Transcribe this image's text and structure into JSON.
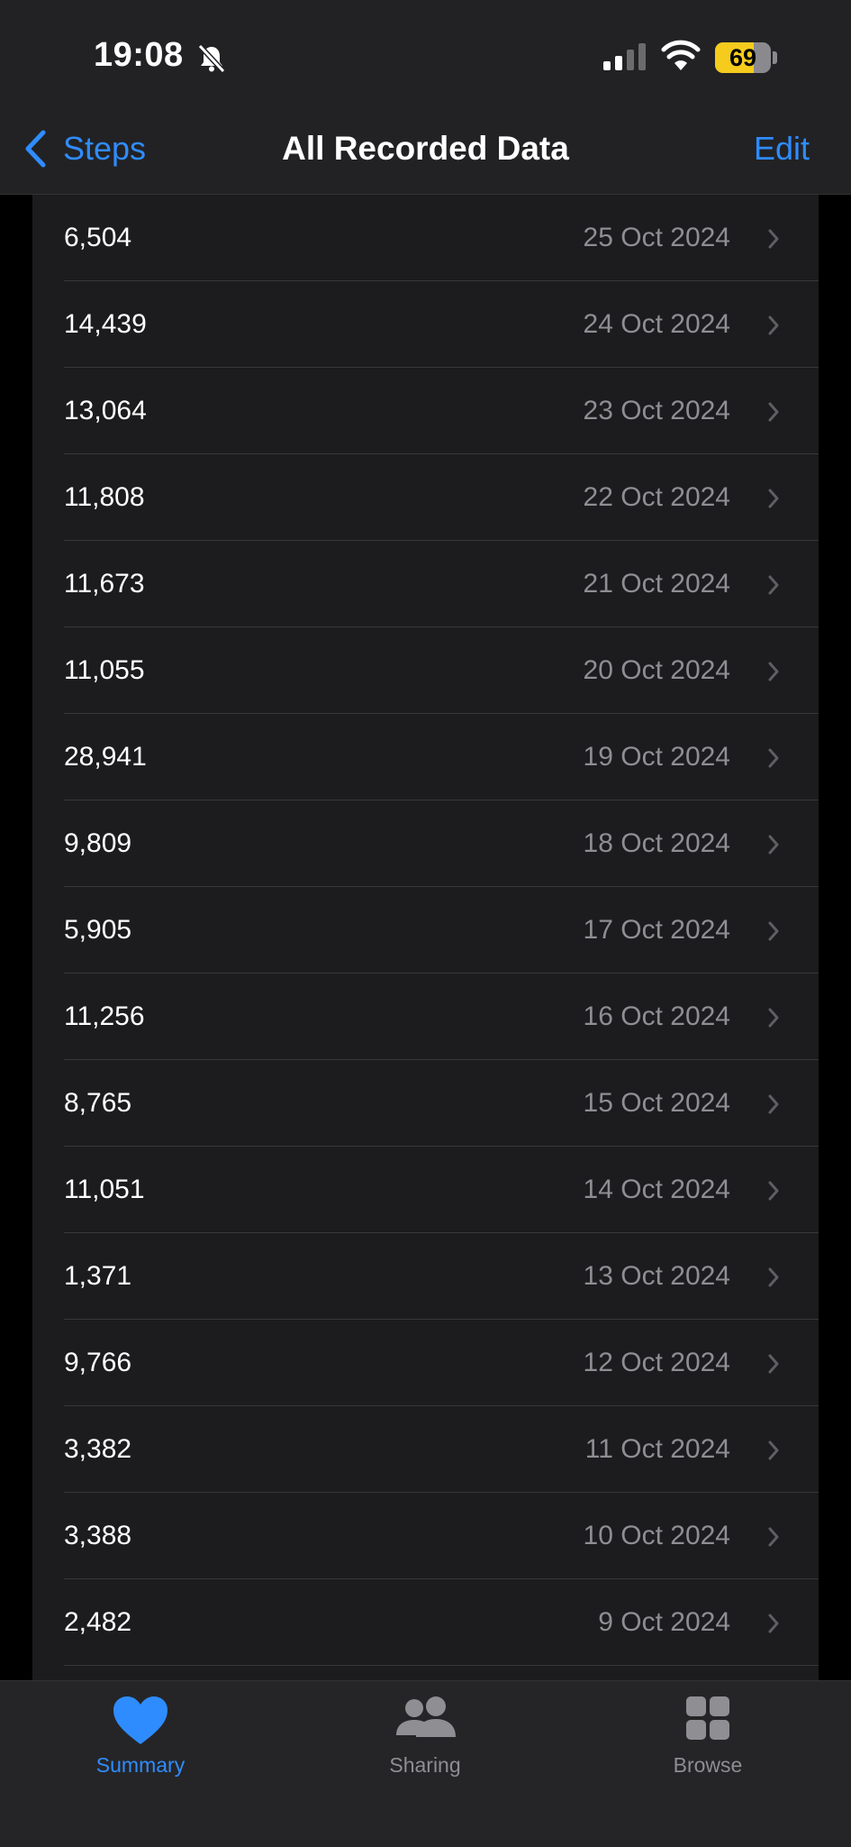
{
  "status_bar": {
    "time": "19:08",
    "battery": "69",
    "battery_level": 0.69,
    "icons": [
      "bell-slash-icon",
      "signal-icon",
      "wifi-icon",
      "battery-icon"
    ]
  },
  "nav": {
    "back_label": "Steps",
    "title": "All Recorded Data",
    "edit_label": "Edit"
  },
  "records": [
    {
      "value": "6,504",
      "date": "25 Oct 2024"
    },
    {
      "value": "14,439",
      "date": "24 Oct 2024"
    },
    {
      "value": "13,064",
      "date": "23 Oct 2024"
    },
    {
      "value": "11,808",
      "date": "22 Oct 2024"
    },
    {
      "value": "11,673",
      "date": "21 Oct 2024"
    },
    {
      "value": "11,055",
      "date": "20 Oct 2024"
    },
    {
      "value": "28,941",
      "date": "19 Oct 2024"
    },
    {
      "value": "9,809",
      "date": "18 Oct 2024"
    },
    {
      "value": "5,905",
      "date": "17 Oct 2024"
    },
    {
      "value": "11,256",
      "date": "16 Oct 2024"
    },
    {
      "value": "8,765",
      "date": "15 Oct 2024"
    },
    {
      "value": "11,051",
      "date": "14 Oct 2024"
    },
    {
      "value": "1,371",
      "date": "13 Oct 2024"
    },
    {
      "value": "9,766",
      "date": "12 Oct 2024"
    },
    {
      "value": "3,382",
      "date": "11 Oct 2024"
    },
    {
      "value": "3,388",
      "date": "10 Oct 2024"
    },
    {
      "value": "2,482",
      "date": "9 Oct 2024"
    }
  ],
  "tabs": [
    {
      "label": "Summary",
      "icon": "heart-icon",
      "active": true
    },
    {
      "label": "Sharing",
      "icon": "people-icon",
      "active": false
    },
    {
      "label": "Browse",
      "icon": "grid-icon",
      "active": false
    }
  ],
  "colors": {
    "accent": "#2f8cff",
    "background": "#000000",
    "list_background": "#1c1c1e",
    "secondary_text": "#8e8e93",
    "battery": "#f5cc1d"
  }
}
